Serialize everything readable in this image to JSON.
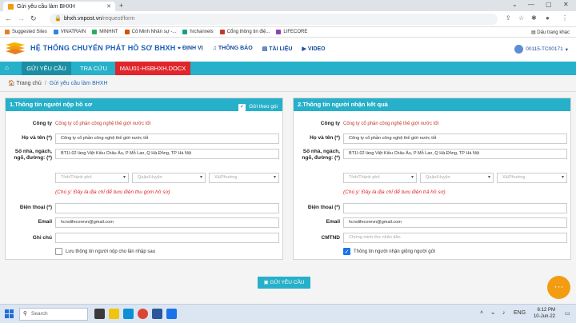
{
  "browser": {
    "tab_title": "Gửi yêu cầu làm BHXH",
    "url_host": "bhxh.vnpost.vn",
    "url_path": "/request/form",
    "bookmarks": [
      "Suggested Sites",
      "VINATRAIN",
      "MINHNT",
      "Cô Minh Nhân sự -...",
      "hrchannels",
      "Cổng thông tin điệ...",
      "LIFECORE"
    ],
    "bookmark_colors": [
      "#e67e22",
      "#2e86de",
      "#27ae60",
      "#d35400",
      "#16a085",
      "#c0392b",
      "#8e44ad"
    ],
    "bookmarks_right": "Dấu trang khác"
  },
  "site": {
    "title": "HỆ THỐNG CHUYỂN PHÁT HỒ SƠ BHXH",
    "nav": [
      "ĐỊNH VỊ",
      "THÔNG BÁO",
      "TÀI LIỆU",
      "VIDEO"
    ],
    "user": "00115-TC00171"
  },
  "menu": {
    "tabs": [
      "GỬI YÊU CẦU",
      "TRA CỨU",
      "MAU01-HSBHXH.DOCX"
    ]
  },
  "breadcrumb": {
    "home": "Trang chủ",
    "current": "Gửi yêu cầu làm BHXH"
  },
  "sender": {
    "title": "1.Thông tin người nộp hồ sơ",
    "group_send_label": "Gửi theo gói",
    "company_label": "Công ty",
    "company_value": "Công ty cổ phần công nghệ thế giới nước tốt",
    "name_label": "Họ và tên (*)",
    "name_value": "Công ty cổ phần công nghệ thế giới nước tốt",
    "address_label": "Số nhà, ngách, ngõ, đường: (*)",
    "address_value": "BT1I-02 làng Việt Kiều Châu Âu, P Mỗ Lao, Q Hà Đông, TP Hà Nội",
    "province_ph": "Tỉnh/Thành phố",
    "district_ph": "Quận/Huyện",
    "ward_ph": "Xã/Phường",
    "note": "(Chú ý: Đây là địa chỉ để bưu điện thu gom hồ sơ)",
    "phone_label": "Điện thoại (*)",
    "phone_value": "",
    "email_label": "Email",
    "email_value": "hcnslifecorevn@gmail.com",
    "memo_label": "Ghi chú",
    "memo_value": "",
    "save_label": "Lưu thông tin người nộp cho lần nhập sau"
  },
  "receiver": {
    "title": "2.Thông tin người nhận kết quả",
    "company_label": "Công ty",
    "company_value": "Công ty cổ phần công nghệ thế giới nước tốt",
    "name_label": "Họ và tên (*)",
    "name_value": "Công ty cổ phần công nghệ thế giới nước tốt",
    "address_label": "Số nhà, ngách, ngõ, đường: (*)",
    "address_value": "BT1I-02 làng Việt Kiều Châu Âu, P Mỗ Lao, Q Hà Đông, TP Hà Nội",
    "province_ph": "Tỉnh/Thành phố",
    "district_ph": "Quận/Huyện",
    "ward_ph": "Xã/Phường",
    "note": "(Chú ý: Đây là địa chỉ để bưu điện trả hồ sơ)",
    "phone_label": "Điện thoại (*)",
    "phone_value": "",
    "email_label": "Email",
    "email_value": "hcnslifecorevn@gmail.com",
    "id_label": "CMTND",
    "id_ph": "Chứng minh thư nhân dân",
    "same_label": "Thông tin người nhận giống người gửi"
  },
  "submit_label": "GỬI YÊU CẦU",
  "taskbar": {
    "search": "Search",
    "time": "6:12 PM",
    "date": "10-Jun-22"
  }
}
